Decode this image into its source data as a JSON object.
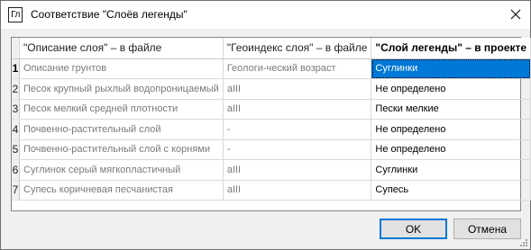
{
  "window": {
    "title": "Соответствие \"Слоёв легенды\"",
    "app_icon_text": "Гл"
  },
  "grid": {
    "columns": [
      "\"Описание слоя\" – в файле",
      "\"Геоиндекс слоя\" – в файле",
      "\"Слой легенды\" – в проекте"
    ],
    "rows": [
      {
        "num": "1",
        "description": "Описание грунтов",
        "geoindex": "Геологи-ческий возраст",
        "legend_layer": "Суглинки"
      },
      {
        "num": "2",
        "description": "Песок крупный рыхлый водопроницаемый",
        "geoindex": "aIII",
        "legend_layer": "Не определено"
      },
      {
        "num": "3",
        "description": "Песок мелкий средней плотности",
        "geoindex": "aIII",
        "legend_layer": "Пески мелкие"
      },
      {
        "num": "4",
        "description": "Почвенно-растительный слой",
        "geoindex": "-",
        "legend_layer": "Не определено"
      },
      {
        "num": "5",
        "description": "Почвенно-растительный слой с корнями",
        "geoindex": "-",
        "legend_layer": "Не определено"
      },
      {
        "num": "6",
        "description": "Суглинок серый мягкопластичный",
        "geoindex": "aIII",
        "legend_layer": "Суглинки"
      },
      {
        "num": "7",
        "description": "Супесь коричневая песчанистая",
        "geoindex": "aIII",
        "legend_layer": "Супесь"
      }
    ],
    "selected_row": 1,
    "selected_column": 3
  },
  "buttons": {
    "ok": "OK",
    "cancel": "Отмена"
  },
  "colors": {
    "selection": "#0078d7",
    "default_button_border": "#0078d7"
  }
}
